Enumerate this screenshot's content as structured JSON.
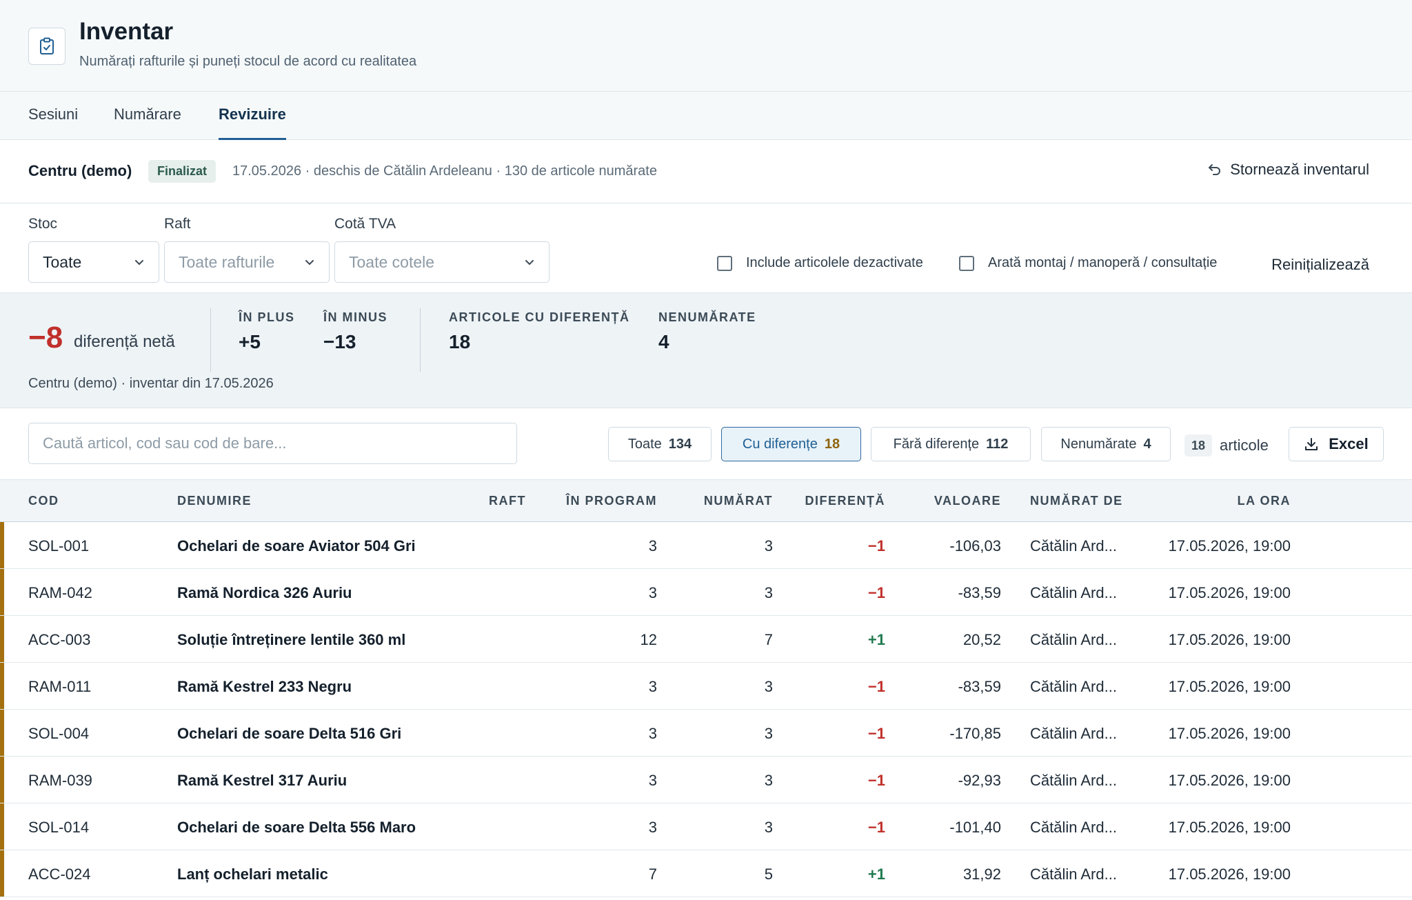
{
  "header": {
    "title": "Inventar",
    "subtitle": "Numărați rafturile și puneți stocul de acord cu realitatea",
    "icon": "clipboard-check-icon"
  },
  "tabs": [
    {
      "label": "Sesiuni",
      "active": false
    },
    {
      "label": "Numărare",
      "active": false
    },
    {
      "label": "Revizuire",
      "active": true
    }
  ],
  "session": {
    "name": "Centru (demo)",
    "status": "Finalizat",
    "meta": "17.05.2026 · deschis de Cătălin Ardeleanu · 130 de articole numărate",
    "storno_label": "Stornează inventarul"
  },
  "filters": {
    "stock_label": "Stoc",
    "stock_value": "Toate",
    "shelf_label": "Raft",
    "shelf_placeholder": "Toate rafturile",
    "vat_label": "Cotă TVA",
    "vat_placeholder": "Toate cotele",
    "include_disabled": "Include articolele dezactivate",
    "show_services": "Arată montaj / manoperă / consultație",
    "reset_label": "Reinițializează"
  },
  "summary": {
    "net_value": "−8",
    "net_label": "diferență netă",
    "plus_label": "ÎN PLUS",
    "plus_value": "+5",
    "minus_label": "ÎN MINUS",
    "minus_value": "−13",
    "diff_label": "ARTICOLE CU DIFERENȚĂ",
    "diff_value": "18",
    "uncounted_label": "NENUMĂRATE",
    "uncounted_value": "4",
    "footer": "Centru (demo) · inventar din 17.05.2026"
  },
  "toolbar": {
    "search_placeholder": "Caută articol, cod sau cod de bare...",
    "chips": [
      {
        "label": "Toate",
        "count": "134",
        "active": false
      },
      {
        "label": "Cu diferențe",
        "count": "18",
        "active": true
      },
      {
        "label": "Fără diferențe",
        "count": "112",
        "active": false
      },
      {
        "label": "Nenumărate",
        "count": "4",
        "active": false
      }
    ],
    "result_count": "18",
    "result_label": "articole",
    "excel_label": "Excel"
  },
  "table": {
    "columns": [
      "COD",
      "DENUMIRE",
      "RAFT",
      "ÎN PROGRAM",
      "NUMĂRAT",
      "DIFERENȚĂ",
      "VALOARE",
      "NUMĂRAT DE",
      "LA ORA"
    ],
    "rows": [
      {
        "code": "SOL-001",
        "name": "Ochelari de soare Aviator 504 Gri",
        "shelf": "",
        "program": "3",
        "counted": "3",
        "diff": "−1",
        "value": "-106,03",
        "by": "Cătălin Ard...",
        "at": "17.05.2026, 19:00"
      },
      {
        "code": "RAM-042",
        "name": "Ramă Nordica 326 Auriu",
        "shelf": "",
        "program": "3",
        "counted": "3",
        "diff": "−1",
        "value": "-83,59",
        "by": "Cătălin Ard...",
        "at": "17.05.2026, 19:00"
      },
      {
        "code": "ACC-003",
        "name": "Soluție întreținere lentile 360 ml",
        "shelf": "",
        "program": "12",
        "counted": "7",
        "diff": "+1",
        "value": "20,52",
        "by": "Cătălin Ard...",
        "at": "17.05.2026, 19:00"
      },
      {
        "code": "RAM-011",
        "name": "Ramă Kestrel 233 Negru",
        "shelf": "",
        "program": "3",
        "counted": "3",
        "diff": "−1",
        "value": "-83,59",
        "by": "Cătălin Ard...",
        "at": "17.05.2026, 19:00"
      },
      {
        "code": "SOL-004",
        "name": "Ochelari de soare Delta 516 Gri",
        "shelf": "",
        "program": "3",
        "counted": "3",
        "diff": "−1",
        "value": "-170,85",
        "by": "Cătălin Ard...",
        "at": "17.05.2026, 19:00"
      },
      {
        "code": "RAM-039",
        "name": "Ramă Kestrel 317 Auriu",
        "shelf": "",
        "program": "3",
        "counted": "3",
        "diff": "−1",
        "value": "-92,93",
        "by": "Cătălin Ard...",
        "at": "17.05.2026, 19:00"
      },
      {
        "code": "SOL-014",
        "name": "Ochelari de soare Delta 556 Maro",
        "shelf": "",
        "program": "3",
        "counted": "3",
        "diff": "−1",
        "value": "-101,40",
        "by": "Cătălin Ard...",
        "at": "17.05.2026, 19:00"
      },
      {
        "code": "ACC-024",
        "name": "Lanț ochelari metalic",
        "shelf": "",
        "program": "7",
        "counted": "5",
        "diff": "+1",
        "value": "31,92",
        "by": "Cătălin Ard...",
        "at": "17.05.2026, 19:00"
      }
    ]
  },
  "colors": {
    "negative": "#c0302b",
    "positive": "#1f7a4f",
    "accent": "#1f5f94",
    "row_marker": "#a5700f"
  }
}
